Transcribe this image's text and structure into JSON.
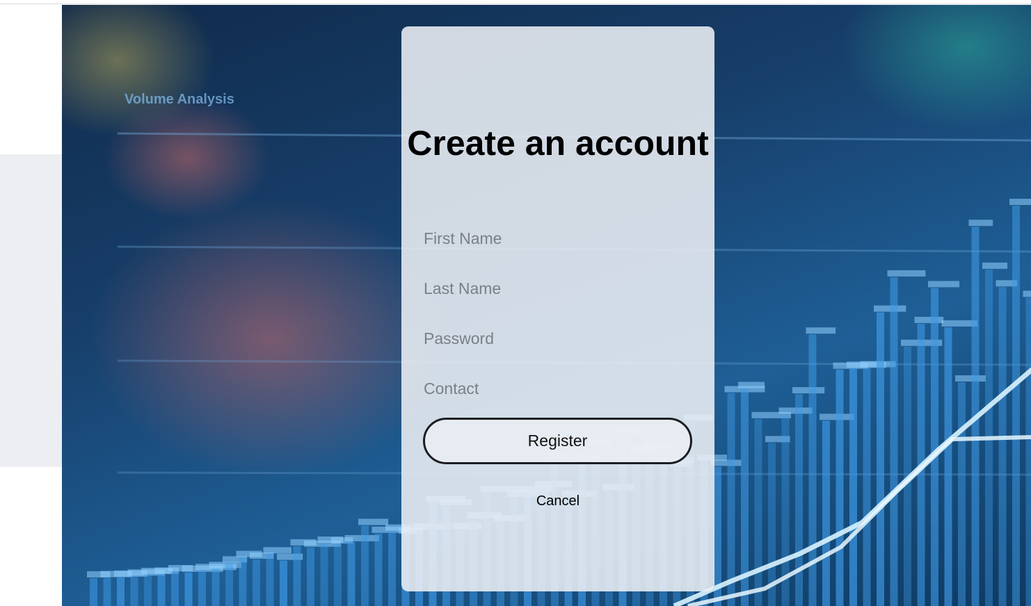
{
  "form": {
    "title": "Create an account",
    "fields": [
      {
        "placeholder": "First Name",
        "value": ""
      },
      {
        "placeholder": "Last Name",
        "value": ""
      },
      {
        "placeholder": "Password",
        "value": ""
      },
      {
        "placeholder": "Contact",
        "value": ""
      }
    ],
    "register_label": "Register",
    "cancel_label": "Cancel"
  },
  "background": {
    "caption": "Volume Analysis"
  },
  "colors": {
    "card": "#eceff4",
    "button_border": "#1b1d22",
    "hero_blue": "#1e5f96",
    "bar_blue": "#3f9ae6"
  }
}
